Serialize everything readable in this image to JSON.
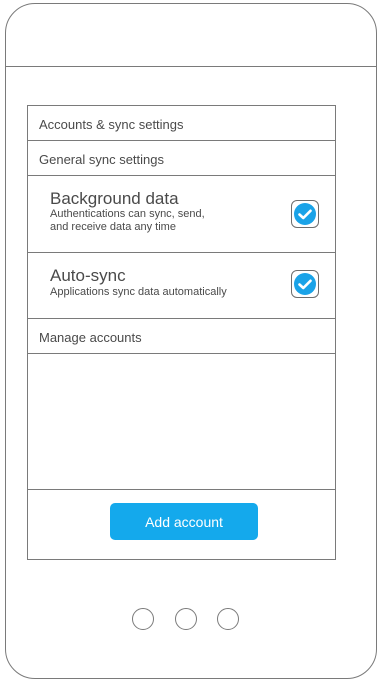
{
  "header": {
    "title": "Accounts & sync settings"
  },
  "sections": {
    "general": "General sync settings",
    "manage": "Manage accounts"
  },
  "settings": [
    {
      "title": "Background data",
      "description_line1": "Authentications can sync, send,",
      "description_line2": "and receive data any time",
      "checked": true
    },
    {
      "title": "Auto-sync",
      "description_line1": "Applications sync data automatically",
      "checked": true
    }
  ],
  "actions": {
    "add_account_label": "Add account"
  },
  "colors": {
    "accent": "#14a9ec",
    "check": "#1aa3e8",
    "outline": "#7a7a7a"
  },
  "icons": {
    "checkbox": "checkmark-icon",
    "nav": [
      "nav-dot-icon",
      "nav-dot-icon",
      "nav-dot-icon"
    ]
  }
}
